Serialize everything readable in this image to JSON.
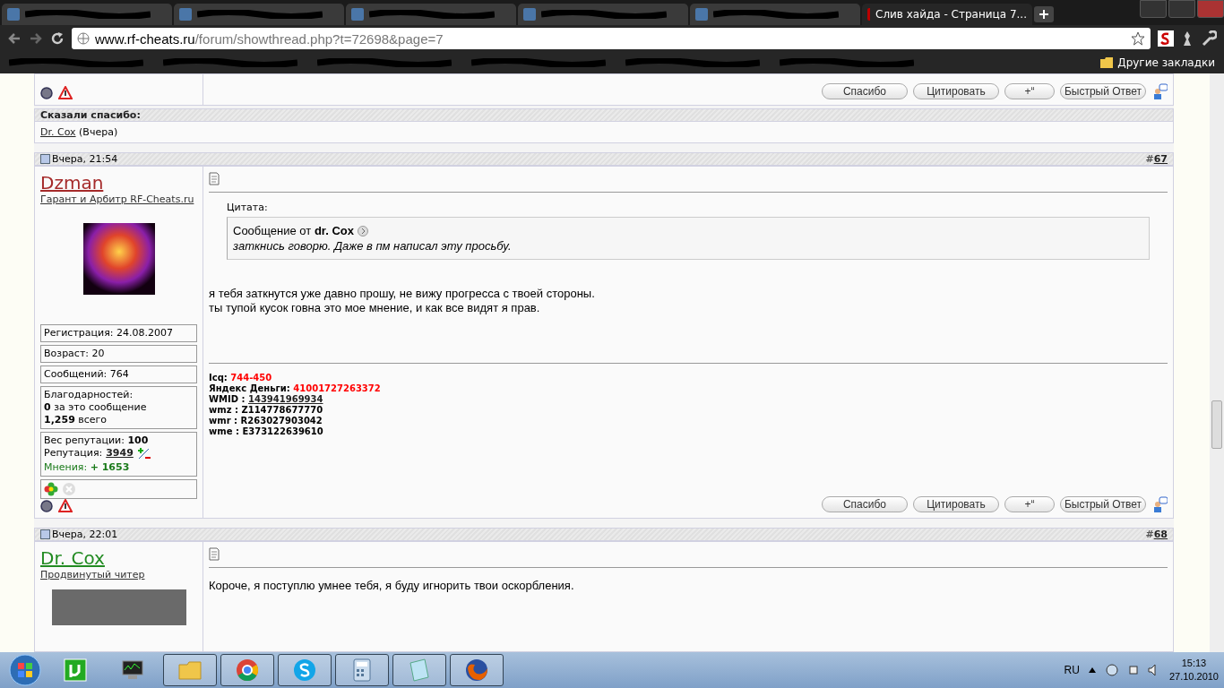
{
  "browser": {
    "tabs": [
      {
        "redacted": true,
        "selected": false
      },
      {
        "redacted": true,
        "selected": false
      },
      {
        "redacted": true,
        "selected": false
      },
      {
        "redacted": true,
        "selected": false
      },
      {
        "redacted": true,
        "selected": false
      },
      {
        "redacted": false,
        "label": "Слив хайда - Страница 7...",
        "selected": true
      }
    ],
    "address": {
      "host": "www.rf-cheats.ru",
      "path": "/forum/showthread.php?t=72698&page=7"
    },
    "bookmarks": [
      {
        "redacted": true
      },
      {
        "redacted": true
      },
      {
        "redacted": true
      },
      {
        "redacted": true
      },
      {
        "redacted": true
      },
      {
        "redacted": true
      }
    ],
    "other_bookmarks": "Другие закладки"
  },
  "previous_post_buttons": [
    "Спасибо",
    "Цитировать",
    "+“",
    "Быстрый Ответ"
  ],
  "thanks": {
    "title": "Сказали спасибо:",
    "user": "Dr. Cox",
    "when": "(Вчера)"
  },
  "posts": [
    {
      "date": "Вчера, 21:54",
      "hash": "#",
      "number": "67",
      "username": "Dzman",
      "color": "#a52a2a",
      "user_title": "Гарант и Арбитр RF-Cheats.ru",
      "has_avatar": true,
      "stats": [
        "Регистрация: 24.08.2007",
        "Возраст: 20",
        "Сообщений: 764"
      ],
      "thanks_lines": [
        "Благодарностей:",
        "**0** за это сообщение",
        "**1,259** всего"
      ],
      "reputation_weight": "Вес репутации: **100**",
      "reputation_label": "Репутация:",
      "reputation_value": "3949",
      "opinions_label": "Мнения:",
      "opinions_value": "+ 1653",
      "quote": {
        "label": "Цитата:",
        "from": "Сообщение от **dr. Cox**",
        "text": "заткнись говорю. Даже в пм написал эту просьбу."
      },
      "message": [
        "я тебя заткнутся уже давно прошу, не вижу прогресса с твоей стороны.",
        "ты тупой кусок говна это мое мнение, и как все видят я прав."
      ],
      "signature": [
        {
          "label": "Icq:",
          "value": "744-450",
          "kind": "red"
        },
        {
          "label": "Яндекс Деньги:",
          "value": "41001727263372",
          "kind": "red"
        },
        {
          "label": "WMID :",
          "value": "143941969934",
          "kind": "link"
        },
        {
          "label": "wmz :",
          "value": "Z114778677770",
          "kind": "plain"
        },
        {
          "label": "wmr :",
          "value": "R263027903042",
          "kind": "plain"
        },
        {
          "label": "wme :",
          "value": "E373122639610",
          "kind": "plain"
        }
      ],
      "buttons": [
        "Спасибо",
        "Цитировать",
        "+“",
        "Быстрый Ответ"
      ]
    },
    {
      "date": "Вчера, 22:01",
      "hash": "#",
      "number": "68",
      "username": "Dr. Cox",
      "color": "#228b22",
      "user_title": "Продвинутый читер",
      "has_avatar": true,
      "message": [
        "Короче, я поступлю умнее тебя, я буду игнорить твои оскорбления."
      ]
    }
  ],
  "taskbar": {
    "apps": [
      {
        "kind": "utorrent",
        "running": false
      },
      {
        "kind": "monitor",
        "running": false
      },
      {
        "kind": "folder",
        "running": true
      },
      {
        "kind": "chrome",
        "running": true
      },
      {
        "kind": "skype",
        "running": true
      },
      {
        "kind": "calculator",
        "running": true
      },
      {
        "kind": "notepad",
        "running": true
      },
      {
        "kind": "firefox",
        "running": true
      }
    ],
    "language": "RU",
    "time": "15:13",
    "date": "27.10.2010"
  }
}
